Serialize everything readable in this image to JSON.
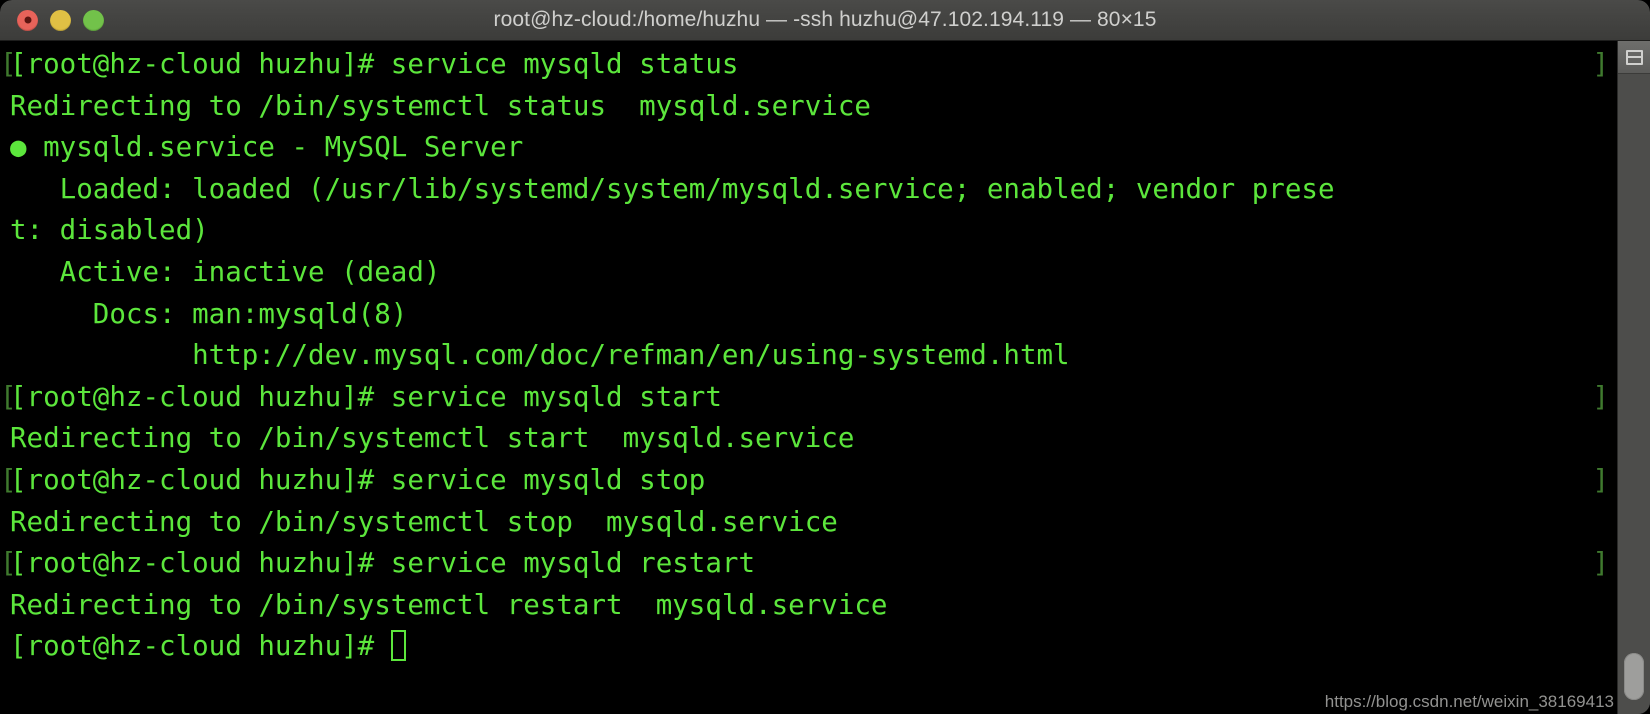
{
  "window": {
    "title": "root@hz-cloud:/home/huzhu — -ssh huzhu@47.102.194.119 — 80×15",
    "traffic_lights": [
      {
        "name": "close",
        "color": "#e8635a"
      },
      {
        "name": "minimize",
        "color": "#e0c044"
      },
      {
        "name": "zoom",
        "color": "#72c24a"
      }
    ]
  },
  "theme": {
    "background": "#000000",
    "foreground": "#5ce63c",
    "prompt_mark": "#3f7a2e",
    "titlebar": "#434341",
    "titlebar_text": "#cfcfcd",
    "scrollbar_track": "#4d4d4b",
    "scrollbar_thumb": "#9e9e9c"
  },
  "terminal": {
    "cols": 80,
    "rows": 15,
    "prompt_mark_left": "[",
    "prompt_mark_right": "]",
    "lines": [
      {
        "text": "[root@hz-cloud huzhu]# service mysqld status",
        "mark": true
      },
      {
        "text": "Redirecting to /bin/systemctl status  mysqld.service",
        "mark": false
      },
      {
        "text": "● mysqld.service - MySQL Server",
        "mark": false
      },
      {
        "text": "   Loaded: loaded (/usr/lib/systemd/system/mysqld.service; enabled; vendor prese",
        "mark": false
      },
      {
        "text": "t: disabled)",
        "mark": false
      },
      {
        "text": "   Active: inactive (dead)",
        "mark": false
      },
      {
        "text": "     Docs: man:mysqld(8)",
        "mark": false
      },
      {
        "text": "           http://dev.mysql.com/doc/refman/en/using-systemd.html",
        "mark": false
      },
      {
        "text": "[root@hz-cloud huzhu]# service mysqld start",
        "mark": true
      },
      {
        "text": "Redirecting to /bin/systemctl start  mysqld.service",
        "mark": false
      },
      {
        "text": "[root@hz-cloud huzhu]# service mysqld stop",
        "mark": true
      },
      {
        "text": "Redirecting to /bin/systemctl stop  mysqld.service",
        "mark": false
      },
      {
        "text": "[root@hz-cloud huzhu]# service mysqld restart",
        "mark": true
      },
      {
        "text": "Redirecting to /bin/systemctl restart  mysqld.service",
        "mark": false
      }
    ],
    "final_prompt": "[root@hz-cloud huzhu]# ",
    "cursor": "block-outline"
  },
  "scrollbar": {
    "split_pane_icon": "split-pane-icon"
  },
  "watermark": {
    "text": "https://blog.csdn.net/weixin_38169413"
  }
}
